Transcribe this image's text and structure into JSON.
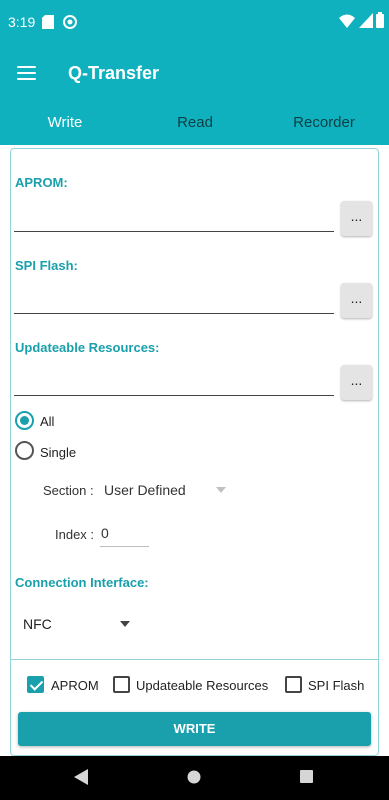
{
  "status_bar": {
    "time": "3:19"
  },
  "app_bar": {
    "title": "Q-Transfer"
  },
  "tabs": [
    {
      "label": "Write",
      "selected": true
    },
    {
      "label": "Read",
      "selected": false
    },
    {
      "label": "Recorder",
      "selected": false
    }
  ],
  "form": {
    "aprom": {
      "label": "APROM:",
      "value": "",
      "browse_label": "..."
    },
    "spi_flash": {
      "label": "SPI Flash:",
      "value": "",
      "browse_label": "..."
    },
    "updateable_resources": {
      "label": "Updateable Resources:",
      "value": "",
      "browse_label": "..."
    },
    "mode_options": [
      {
        "label": "All",
        "selected": true
      },
      {
        "label": "Single",
        "selected": false
      }
    ],
    "section": {
      "label": "Section :",
      "value": "User Defined"
    },
    "index": {
      "label": "Index :",
      "placeholder": "0"
    },
    "connection": {
      "label": "Connection Interface:",
      "value": "NFC"
    }
  },
  "footer": {
    "checkboxes": [
      {
        "label": "APROM",
        "checked": true
      },
      {
        "label": "Updateable Resources",
        "checked": false
      },
      {
        "label": "SPI Flash",
        "checked": false
      }
    ],
    "write_label": "WRITE"
  },
  "colors": {
    "primary": "#0fb1be",
    "accent": "#1aa0ac"
  }
}
